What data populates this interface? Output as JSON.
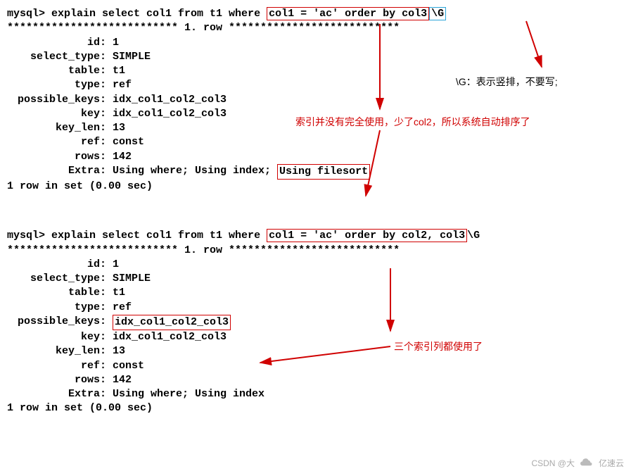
{
  "query1": {
    "prompt": "mysql> ",
    "cmd_prefix": "explain select col1 from t1 where ",
    "cmd_boxed": "col1 = 'ac' order by col3",
    "cmd_suffix": "\\G",
    "row_header": "*************************** 1. row ***************************",
    "rows": {
      "id": "1",
      "select_type": "SIMPLE",
      "table": "t1",
      "type": "ref",
      "possible_keys": "idx_col1_col2_col3",
      "key": "idx_col1_col2_col3",
      "key_len": "13",
      "ref": "const",
      "rows_count": "142",
      "extra_prefix": "Using where; Using index; ",
      "extra_boxed": "Using filesort"
    },
    "footer": "1 row in set (0.00 sec)"
  },
  "query2": {
    "prompt": "mysql> ",
    "cmd_prefix": "explain select col1 from t1 where ",
    "cmd_boxed": "col1 = 'ac' order by col2, col3",
    "cmd_suffix": "\\G",
    "row_header": "*************************** 1. row ***************************",
    "rows": {
      "id": "1",
      "select_type": "SIMPLE",
      "table": "t1",
      "type": "ref",
      "possible_keys_boxed": "idx_col1_col2_col3",
      "key": "idx_col1_col2_col3",
      "key_len": "13",
      "ref": "const",
      "rows_count": "142",
      "extra": "Using where; Using index"
    },
    "footer": "1 row in set (0.00 sec)"
  },
  "labels": {
    "id": "id: ",
    "select_type": "select_type: ",
    "table": "table: ",
    "type": "type: ",
    "possible_keys": "possible_keys: ",
    "key": "key: ",
    "key_len": "key_len: ",
    "ref": "ref: ",
    "rows": "rows: ",
    "extra": "Extra: "
  },
  "annotations": {
    "note_g": "\\G：表示竖排，不要写;",
    "note_filesort": "索引并没有完全使用，少了col2，所以系统自动排序了",
    "note_all_used": "三个索引列都使用了"
  },
  "watermark": {
    "csdn": "CSDN @大",
    "logo": "亿速云"
  },
  "icons": {
    "cloud": "cloud-icon"
  }
}
